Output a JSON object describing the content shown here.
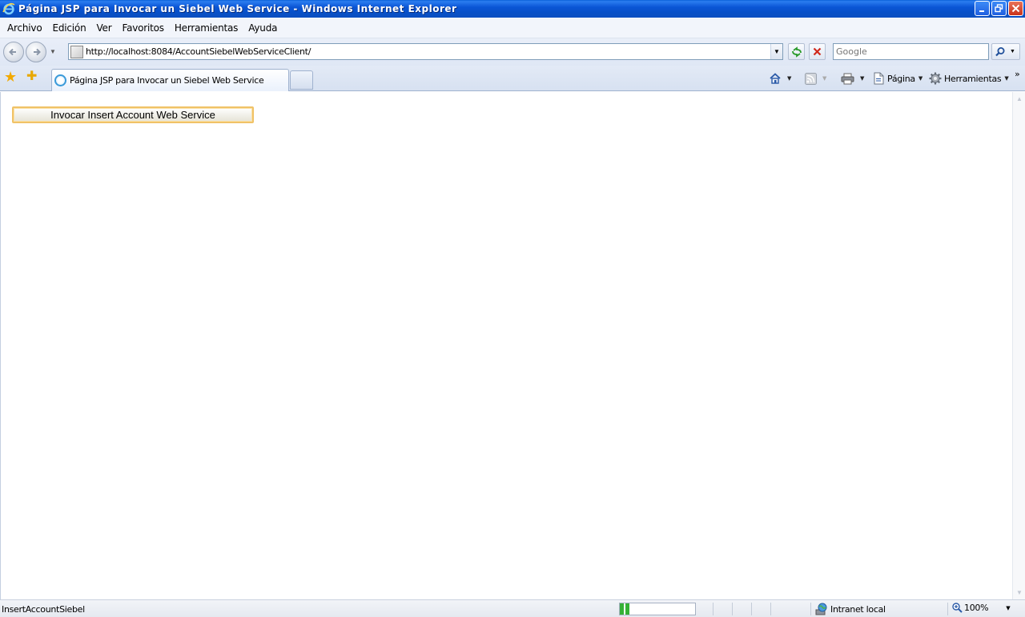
{
  "window": {
    "title": "Página JSP para Invocar un Siebel Web Service - Windows Internet Explorer"
  },
  "menu": {
    "items": [
      "Archivo",
      "Edición",
      "Ver",
      "Favoritos",
      "Herramientas",
      "Ayuda"
    ]
  },
  "address_bar": {
    "url": "http://localhost:8084/AccountSiebelWebServiceClient/"
  },
  "search": {
    "placeholder": "Google"
  },
  "tabs": [
    {
      "label": "Página JSP para Invocar un Siebel Web Service",
      "active": true
    }
  ],
  "command_bar": {
    "page_label": "Página",
    "tools_label": "Herramientas"
  },
  "content": {
    "invoke_button_label": "Invocar Insert Account Web Service"
  },
  "status_bar": {
    "text": "InsertAccountSiebel",
    "zone": "Intranet local",
    "zoom": "100%",
    "progress_fraction": 0.15
  },
  "icons": {
    "back": "back-arrow-icon",
    "forward": "forward-arrow-icon",
    "refresh": "refresh-icon",
    "stop": "stop-icon",
    "search": "search-icon",
    "favorites": "star-icon",
    "add_favorites": "add-favorite-icon",
    "home": "home-icon",
    "feeds": "rss-icon",
    "print": "print-icon",
    "page": "page-icon",
    "tools": "gear-icon",
    "zone": "globe-icon",
    "zoom": "zoom-icon"
  },
  "colors": {
    "titlebar": "#0b56d6",
    "button_border": "#f0c267"
  }
}
